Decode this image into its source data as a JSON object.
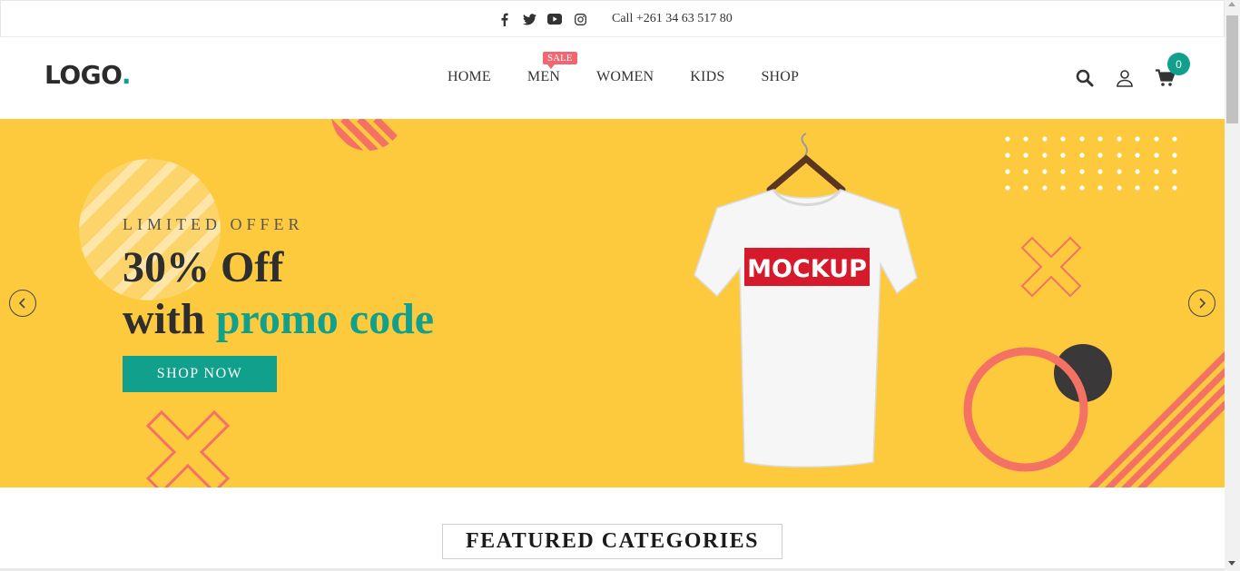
{
  "topbar": {
    "social_icons": [
      "facebook-icon",
      "twitter-icon",
      "youtube-icon",
      "instagram-icon"
    ],
    "phone": "Call +261 34 63 517 80"
  },
  "header": {
    "logo_text": "LOGO",
    "logo_dot": ".",
    "nav": [
      {
        "label": "HOME"
      },
      {
        "label": "MEN"
      },
      {
        "label": "WOMEN"
      },
      {
        "label": "KIDS"
      },
      {
        "label": "SHOP"
      }
    ],
    "sale_badge": "SALE",
    "icons": [
      "search-icon",
      "user-icon",
      "cart-icon"
    ],
    "cart_count": "0"
  },
  "hero": {
    "kicker": "LIMITED OFFER",
    "headline_line1": "30% Off",
    "headline_line2_prefix": "with ",
    "headline_line2_accent": "promo code",
    "button_label": "SHOP NOW",
    "product_print": "MOCKUP"
  },
  "featured": {
    "title": "FEATURED CATEGORIES"
  },
  "colors": {
    "accent": "#11a08b",
    "hero_bg": "#fdca3d",
    "sale": "#f06671",
    "coral": "#f47264"
  }
}
